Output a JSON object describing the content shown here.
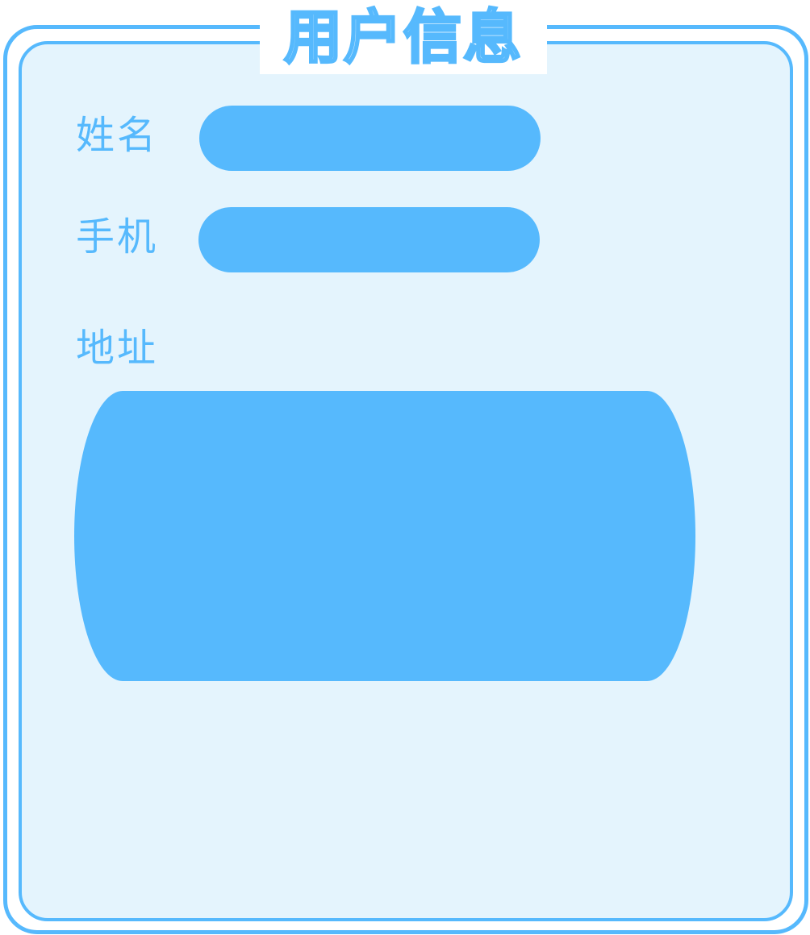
{
  "title": "用户信息",
  "form": {
    "name_label": "姓名",
    "name_value": "",
    "phone_label": "手机",
    "phone_value": "",
    "address_label": "地址",
    "address_value": ""
  },
  "colors": {
    "accent": "#56b9fd",
    "panel_background": "#e4f4fd",
    "page_background": "#ffffff"
  }
}
